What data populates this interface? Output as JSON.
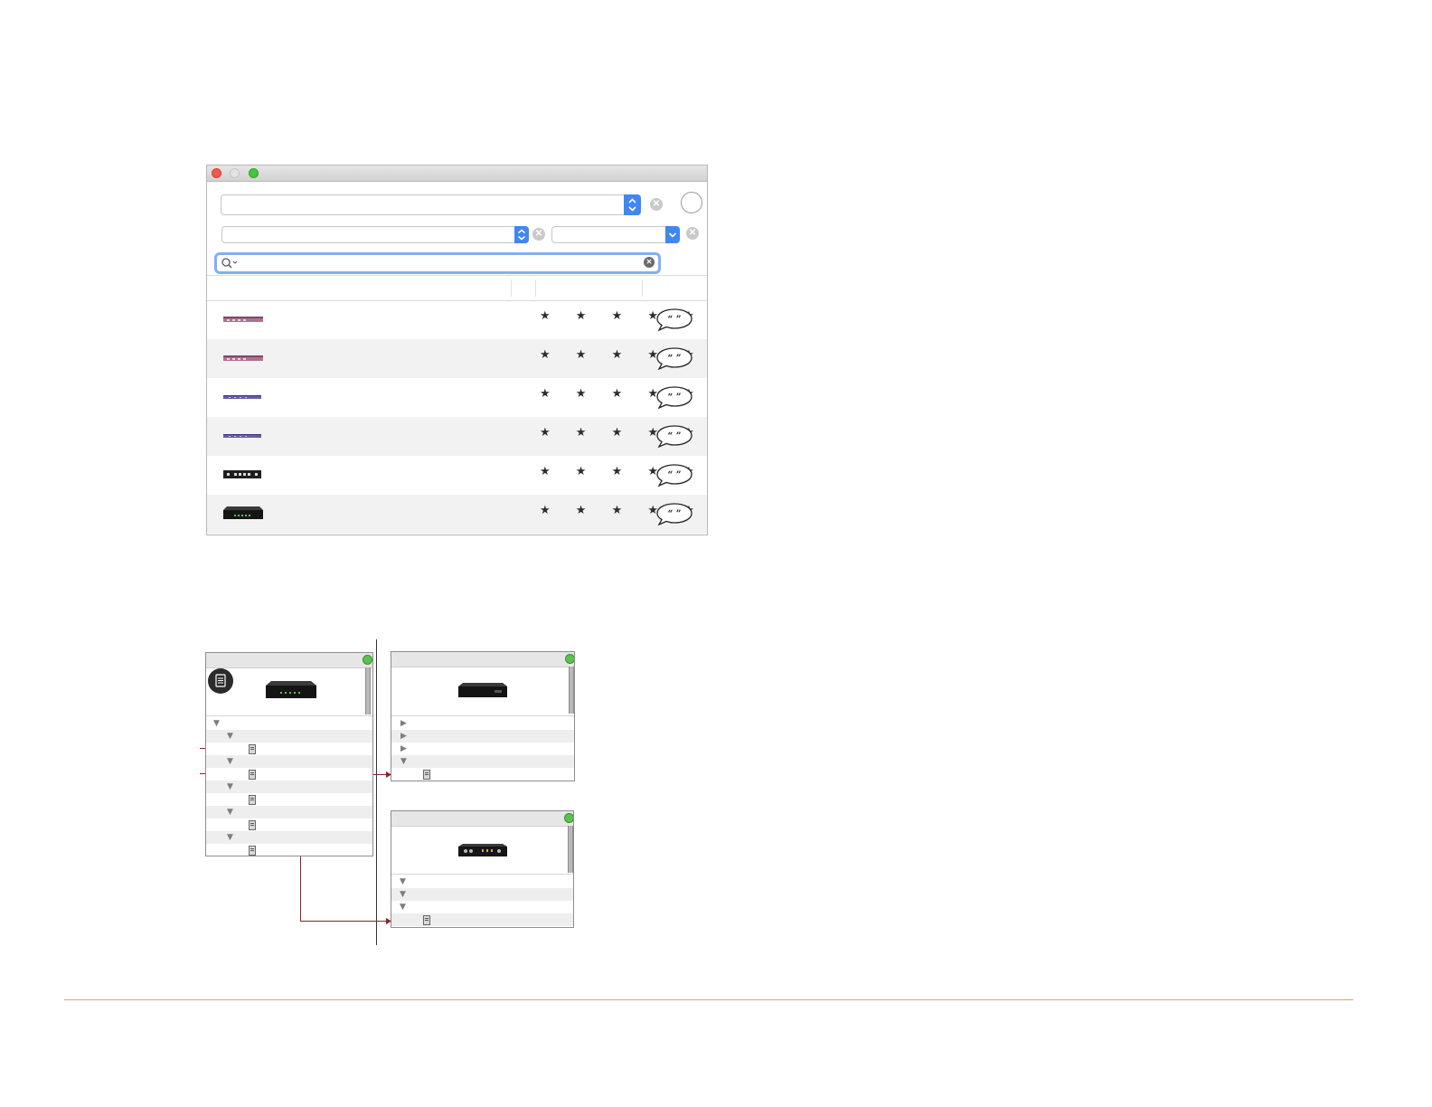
{
  "window": {
    "traffic_lights": {
      "close": "#f25a50",
      "minimize": "#dadada",
      "zoom": "#43c641"
    },
    "primary_select": {
      "value": "",
      "icon": "updown-chevron-icon"
    },
    "secondary_select": {
      "value": "",
      "icon": "updown-chevron-icon"
    },
    "tertiary_select": {
      "value": "",
      "icon": "chevron-down-icon"
    },
    "search": {
      "value": "",
      "placeholder": ""
    },
    "accent_color": "#3f87f2",
    "rows": [
      {
        "device": "switch-purple",
        "rating": 0
      },
      {
        "device": "switch-purple",
        "rating": 0
      },
      {
        "device": "switch-slim-purple",
        "rating": 0
      },
      {
        "device": "switch-slim-purple",
        "rating": 0
      },
      {
        "device": "switch-black-ports",
        "rating": 0
      },
      {
        "device": "amplifier-black",
        "rating": 0
      }
    ],
    "star_glyphs": "★ ★ ★ ★ ★",
    "review_glyph": "“ ”"
  },
  "panels": [
    {
      "name": "source",
      "status_color": "#5ac34f",
      "tree": [
        "expanded",
        "expanded",
        "item",
        "expanded",
        "item",
        "expanded",
        "item",
        "expanded",
        "item",
        "expanded",
        "item"
      ]
    },
    {
      "name": "destination-1",
      "status_color": "#5ac34f",
      "tree": [
        "collapsed",
        "collapsed",
        "collapsed",
        "expanded",
        "item"
      ]
    },
    {
      "name": "destination-2",
      "status_color": "#5ac34f",
      "tree": [
        "expanded",
        "expanded",
        "expanded",
        "item"
      ]
    }
  ],
  "wire_color": "#8b2130",
  "footer_rule_color": "#e0a070"
}
